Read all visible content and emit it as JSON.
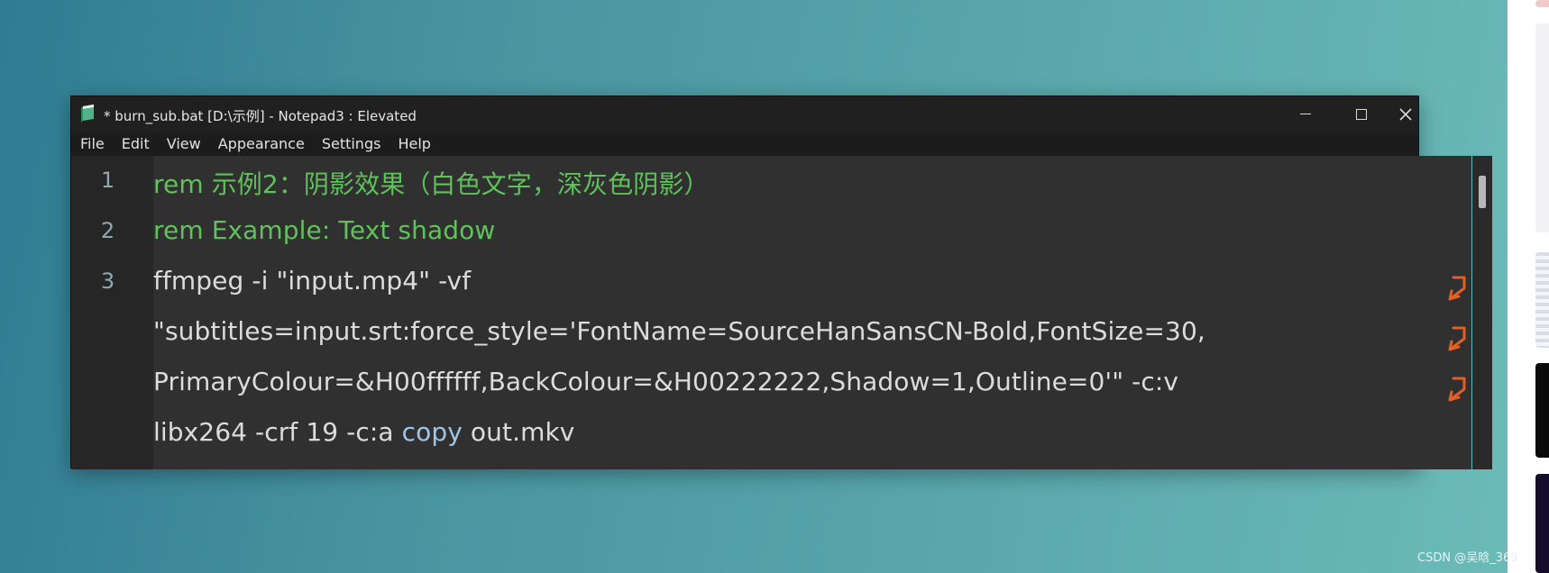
{
  "window": {
    "title": "* burn_sub.bat [D:\\示例] - Notepad3 : Elevated",
    "icon": "notepad3-app-icon",
    "controls": {
      "minimize": "minimize-icon",
      "maximize": "maximize-icon",
      "close": "✕"
    }
  },
  "menu": {
    "items": [
      "File",
      "Edit",
      "View",
      "Appearance",
      "Settings",
      "Help"
    ]
  },
  "editor": {
    "line_numbers": [
      "1",
      "2",
      "3"
    ],
    "lines": [
      {
        "tokens": [
          {
            "text": "rem 示例2：阴影效果（白色文字，深灰色阴影）",
            "kind": "comment"
          }
        ]
      },
      {
        "tokens": [
          {
            "text": "rem Example: Text shadow",
            "kind": "comment"
          }
        ]
      },
      {
        "tokens": [
          {
            "text": "ffmpeg -i \"input.mp4\" -vf",
            "kind": "plain"
          }
        ],
        "wrapped": true
      },
      {
        "tokens": [
          {
            "text": "\"subtitles=input.srt:force_style='FontName=SourceHanSansCN-Bold,FontSize=30,",
            "kind": "plain"
          }
        ],
        "wrapped": true
      },
      {
        "tokens": [
          {
            "text": "PrimaryColour=&H00ffffff,BackColour=&H00222222,Shadow=1,Outline=0'\" -c:v",
            "kind": "plain"
          }
        ],
        "wrapped": true
      },
      {
        "tokens": [
          {
            "text": "libx264 -crf 19 -c:a ",
            "kind": "plain"
          },
          {
            "text": "copy",
            "kind": "keyword"
          },
          {
            "text": " out.mkv",
            "kind": "plain"
          }
        ]
      }
    ],
    "wrap_icon": "wrap-arrow-icon",
    "colors": {
      "comment": "#5fc25a",
      "keyword": "#9fc6e6",
      "text": "#dcdcdc",
      "wrap": "#e0602a"
    }
  },
  "watermark": {
    "text": "CSDN @吴晗_369"
  }
}
